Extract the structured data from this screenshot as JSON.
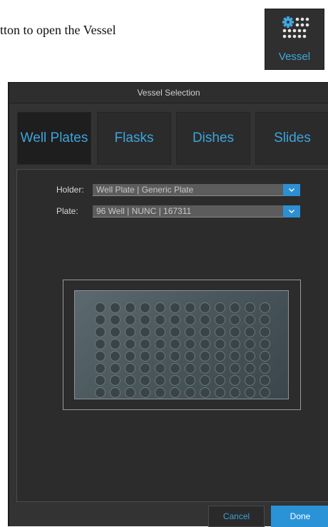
{
  "instruction": {
    "text": "tton to open the Vessel"
  },
  "vessel_button": {
    "label": "Vessel",
    "icon": "gear-dots-icon"
  },
  "dialog": {
    "title": "Vessel Selection",
    "tabs": [
      {
        "label": "Well Plates",
        "active": true
      },
      {
        "label": "Flasks",
        "active": false
      },
      {
        "label": "Dishes",
        "active": false
      },
      {
        "label": "Slides",
        "active": false
      }
    ],
    "holder": {
      "label": "Holder:",
      "value": "Well Plate | Generic Plate"
    },
    "plate": {
      "label": "Plate:",
      "value": "96 Well | NUNC | 167311"
    },
    "well_plate": {
      "rows": 8,
      "columns": 12
    },
    "buttons": {
      "cancel": "Cancel",
      "done": "Done"
    }
  },
  "colors": {
    "accent": "#3da4dc",
    "dialog_bg": "#333333",
    "primary_button": "#2a93d8"
  }
}
